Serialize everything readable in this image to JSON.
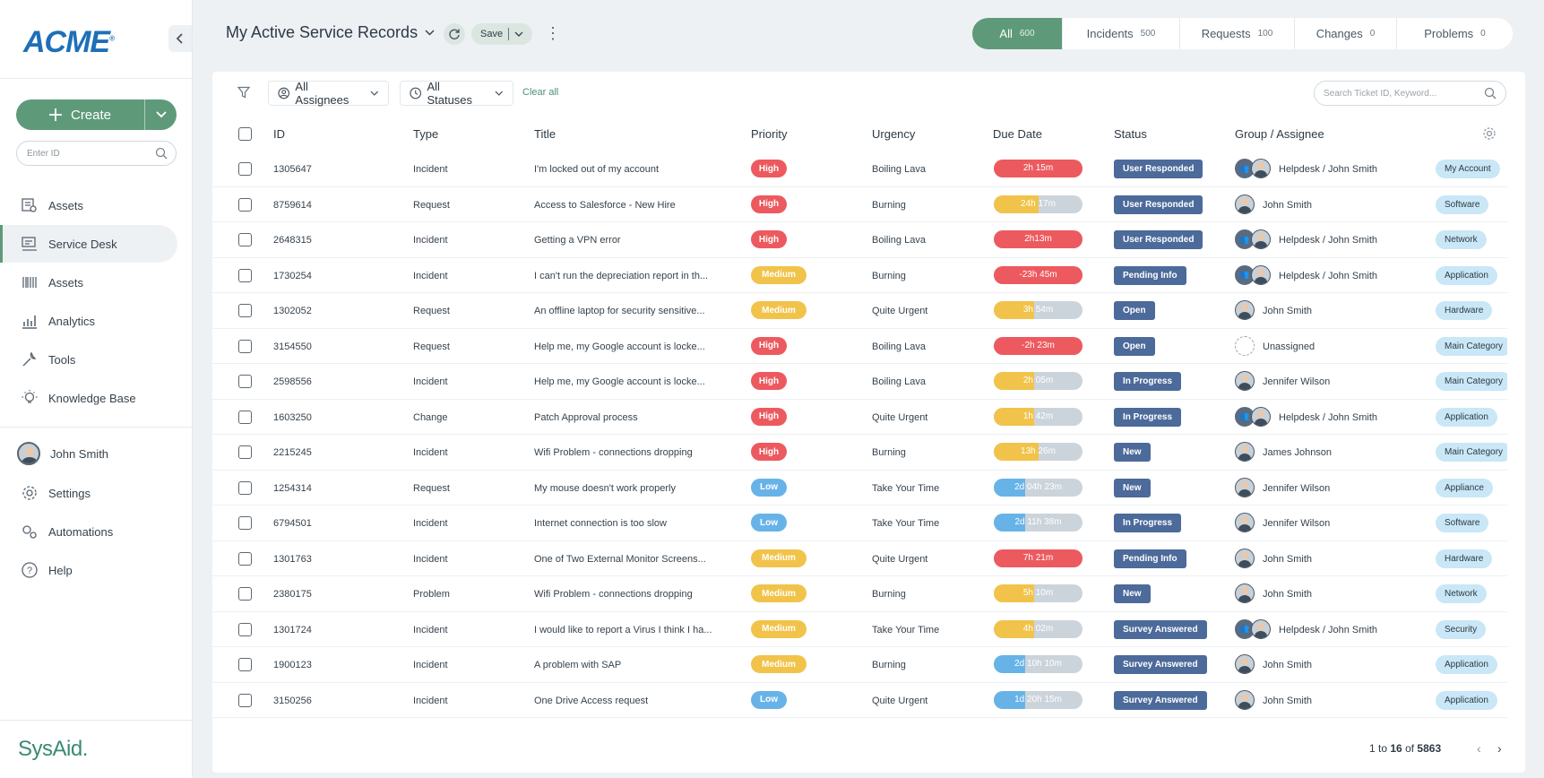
{
  "sidebar": {
    "logo": "ACME",
    "create_label": "Create",
    "enter_id_placeholder": "Enter ID",
    "nav": [
      {
        "label": "Assets",
        "icon": "assets-icon"
      },
      {
        "label": "Service Desk",
        "icon": "service-desk-icon",
        "active": true
      },
      {
        "label": "Assets",
        "icon": "barcode-icon"
      },
      {
        "label": "Analytics",
        "icon": "analytics-icon"
      },
      {
        "label": "Tools",
        "icon": "tools-icon"
      },
      {
        "label": "Knowledge Base",
        "icon": "lightbulb-icon"
      }
    ],
    "user": {
      "name": "John Smith"
    },
    "bottom_nav": [
      {
        "label": "Settings",
        "icon": "gear-icon"
      },
      {
        "label": "Automations",
        "icon": "automations-icon"
      },
      {
        "label": "Help",
        "icon": "help-icon"
      }
    ],
    "brand": "SysAid."
  },
  "header": {
    "title": "My Active Service Records",
    "save_label": "Save",
    "tabs": [
      {
        "label": "All",
        "count": "600",
        "active": true
      },
      {
        "label": "Incidents",
        "count": "500"
      },
      {
        "label": "Requests",
        "count": "100"
      },
      {
        "label": "Changes",
        "count": "0"
      },
      {
        "label": "Problems",
        "count": "0"
      }
    ]
  },
  "filters": {
    "assignees": "All Assignees",
    "statuses": "All Statuses",
    "clear_all": "Clear all",
    "search_placeholder": "Search Ticket ID, Keyword..."
  },
  "table": {
    "columns": [
      "ID",
      "Type",
      "Title",
      "Priority",
      "Urgency",
      "Due Date",
      "Status",
      "Group / Assignee"
    ],
    "rows": [
      {
        "id": "1305647",
        "type": "Incident",
        "title": "I'm locked out of my account",
        "priority": "High",
        "urgency": "Boiling Lava",
        "due": "2h 15m",
        "due_color": "#ec5a5f",
        "due_fill": 1.0,
        "status": "User Responded",
        "assignee": "Helpdesk / John Smith",
        "avatar": "group",
        "category": "My Account"
      },
      {
        "id": "8759614",
        "type": "Request",
        "title": "Access to Salesforce - New Hire",
        "priority": "High",
        "urgency": "Burning",
        "due": "24h 17m",
        "due_color": "#f1c34a",
        "due_fill": 0.5,
        "status": "User Responded",
        "assignee": "John Smith",
        "avatar": "person",
        "category": "Software"
      },
      {
        "id": "2648315",
        "type": "Incident",
        "title": "Getting a VPN error",
        "priority": "High",
        "urgency": "Boiling Lava",
        "due": "2h13m",
        "due_color": "#ec5a5f",
        "due_fill": 1.0,
        "status": "User Responded",
        "assignee": "Helpdesk / John Smith",
        "avatar": "group",
        "category": "Network"
      },
      {
        "id": "1730254",
        "type": "Incident",
        "title": "I can't run the depreciation report in th...",
        "priority": "Medium",
        "urgency": "Burning",
        "due": "-23h 45m",
        "due_color": "#ec5a5f",
        "due_fill": 1.0,
        "status": "Pending Info",
        "assignee": "Helpdesk / John Smith",
        "avatar": "group",
        "category": "Application"
      },
      {
        "id": "1302052",
        "type": "Request",
        "title": "An offline laptop for security sensitive...",
        "priority": "Medium",
        "urgency": "Quite Urgent",
        "due": "3h 54m",
        "due_color": "#f1c34a",
        "due_fill": 0.45,
        "status": "Open",
        "assignee": "John Smith",
        "avatar": "person",
        "category": "Hardware"
      },
      {
        "id": "3154550",
        "type": "Request",
        "title": "Help me, my Google account is locke...",
        "priority": "High",
        "urgency": "Boiling Lava",
        "due": "-2h 23m",
        "due_color": "#ec5a5f",
        "due_fill": 1.0,
        "status": "Open",
        "assignee": "Unassigned",
        "avatar": "unassigned",
        "category": "Main Category"
      },
      {
        "id": "2598556",
        "type": "Incident",
        "title": "Help me, my Google account is locke...",
        "priority": "High",
        "urgency": "Boiling Lava",
        "due": "2h 05m",
        "due_color": "#f1c34a",
        "due_fill": 0.45,
        "status": "In Progress",
        "assignee": "Jennifer Wilson",
        "avatar": "person",
        "category": "Main Category"
      },
      {
        "id": "1603250",
        "type": "Change",
        "title": "Patch Approval process",
        "priority": "High",
        "urgency": "Quite Urgent",
        "due": "1h 42m",
        "due_color": "#f1c34a",
        "due_fill": 0.45,
        "status": "In Progress",
        "assignee": "Helpdesk / John Smith",
        "avatar": "group",
        "category": "Application"
      },
      {
        "id": "2215245",
        "type": "Incident",
        "title": "Wifi Problem - connections dropping",
        "priority": "High",
        "urgency": "Burning",
        "due": "13h 26m",
        "due_color": "#f1c34a",
        "due_fill": 0.5,
        "status": "New",
        "assignee": "James Johnson",
        "avatar": "person",
        "category": "Main Category"
      },
      {
        "id": "1254314",
        "type": "Request",
        "title": "My mouse doesn't work properly",
        "priority": "Low",
        "urgency": "Take Your Time",
        "due": "2d 04h 23m",
        "due_color": "#67b3e8",
        "due_fill": 0.35,
        "status": "New",
        "assignee": "Jennifer Wilson",
        "avatar": "person",
        "category": "Appliance"
      },
      {
        "id": "6794501",
        "type": "Incident",
        "title": "Internet connection is too slow",
        "priority": "Low",
        "urgency": "Take Your Time",
        "due": "2d 11h 38m",
        "due_color": "#67b3e8",
        "due_fill": 0.35,
        "status": "In Progress",
        "assignee": "Jennifer Wilson",
        "avatar": "person",
        "category": "Software"
      },
      {
        "id": "1301763",
        "type": "Incident",
        "title": "One of Two External Monitor Screens...",
        "priority": "Medium",
        "urgency": "Quite Urgent",
        "due": "7h 21m",
        "due_color": "#ec5a5f",
        "due_fill": 1.0,
        "status": "Pending Info",
        "assignee": "John Smith",
        "avatar": "person",
        "category": "Hardware"
      },
      {
        "id": "2380175",
        "type": "Problem",
        "title": "Wifi Problem - connections dropping",
        "priority": "Medium",
        "urgency": "Burning",
        "due": "5h 10m",
        "due_color": "#f1c34a",
        "due_fill": 0.45,
        "status": "New",
        "assignee": "John Smith",
        "avatar": "person",
        "category": "Network"
      },
      {
        "id": "1301724",
        "type": "Incident",
        "title": "I would like to report a Virus I think I ha...",
        "priority": "Medium",
        "urgency": "Take Your Time",
        "due": "4h 02m",
        "due_color": "#f1c34a",
        "due_fill": 0.45,
        "status": "Survey Answered",
        "assignee": "Helpdesk / John Smith",
        "avatar": "group",
        "category": "Security"
      },
      {
        "id": "1900123",
        "type": "Incident",
        "title": "A problem with SAP",
        "priority": "Medium",
        "urgency": "Burning",
        "due": "2d 10h 10m",
        "due_color": "#67b3e8",
        "due_fill": 0.35,
        "status": "Survey Answered",
        "assignee": "John Smith",
        "avatar": "person",
        "category": "Application"
      },
      {
        "id": "3150256",
        "type": "Incident",
        "title": " One Drive Access request",
        "priority": "Low",
        "urgency": "Quite Urgent",
        "due": "1d 20h 15m",
        "due_color": "#67b3e8",
        "due_fill": 0.35,
        "status": "Survey Answered",
        "assignee": "John Smith",
        "avatar": "person",
        "category": "Application"
      }
    ]
  },
  "pager": {
    "from": "1",
    "to": "16",
    "total": "5863"
  }
}
